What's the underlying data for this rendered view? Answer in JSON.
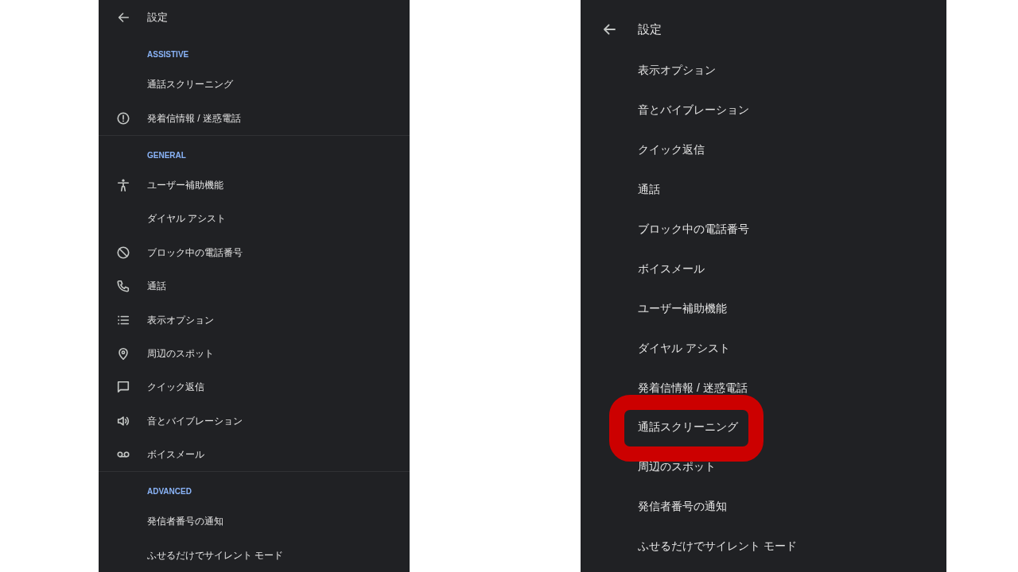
{
  "left_screen": {
    "title": "設定",
    "sections": [
      {
        "label": "ASSISTIVE",
        "items": [
          {
            "label": "通話スクリーニング",
            "kind": "plain"
          },
          {
            "label": "発着信情報 / 迷惑電話",
            "kind": "alert"
          }
        ]
      },
      {
        "label": "GENERAL",
        "items": [
          {
            "label": "ユーザー補助機能",
            "kind": "person"
          },
          {
            "label": "ダイヤル アシスト",
            "kind": "plain"
          },
          {
            "label": "ブロック中の電話番号",
            "kind": "block"
          },
          {
            "label": "通話",
            "kind": "phone"
          },
          {
            "label": "表示オプション",
            "kind": "list"
          },
          {
            "label": "周辺のスポット",
            "kind": "pin"
          },
          {
            "label": "クイック返信",
            "kind": "chat"
          },
          {
            "label": "音とバイブレーション",
            "kind": "speaker"
          },
          {
            "label": "ボイスメール",
            "kind": "voicemail"
          }
        ]
      },
      {
        "label": "ADVANCED",
        "items": [
          {
            "label": "発信者番号の通知",
            "kind": "plain"
          },
          {
            "label": "ふせるだけでサイレント モード",
            "kind": "plain"
          }
        ]
      }
    ]
  },
  "right_screen": {
    "title": "設定",
    "items": [
      {
        "label": "表示オプション",
        "highlighted": false
      },
      {
        "label": "音とバイブレーション",
        "highlighted": false
      },
      {
        "label": "クイック返信",
        "highlighted": false
      },
      {
        "label": "通話",
        "highlighted": false
      },
      {
        "label": "ブロック中の電話番号",
        "highlighted": false
      },
      {
        "label": "ボイスメール",
        "highlighted": false
      },
      {
        "label": "ユーザー補助機能",
        "highlighted": false
      },
      {
        "label": "ダイヤル アシスト",
        "highlighted": false
      },
      {
        "label": "発着信情報 / 迷惑電話",
        "highlighted": false
      },
      {
        "label": "通話スクリーニング",
        "highlighted": true
      },
      {
        "label": "周辺のスポット",
        "highlighted": false
      },
      {
        "label": "発信者番号の通知",
        "highlighted": false
      },
      {
        "label": "ふせるだけでサイレント モード",
        "highlighted": false
      }
    ]
  }
}
